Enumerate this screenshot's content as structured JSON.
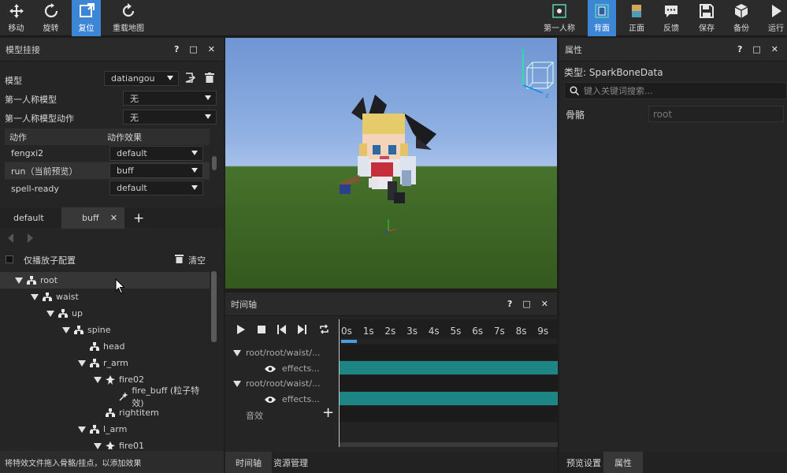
{
  "toolbar": {
    "left": [
      {
        "label": "移动",
        "icon": "move-icon"
      },
      {
        "label": "旋转",
        "icon": "rotate-icon"
      },
      {
        "label": "复位",
        "icon": "reset-icon"
      },
      {
        "label": "重载地图",
        "icon": "reload-icon"
      }
    ],
    "right": [
      {
        "label": "第一人称",
        "icon": "first-person-icon"
      },
      {
        "label": "背面",
        "icon": "back-view-icon"
      },
      {
        "label": "正面",
        "icon": "front-view-icon"
      },
      {
        "label": "反馈",
        "icon": "feedback-icon"
      },
      {
        "label": "保存",
        "icon": "save-icon"
      },
      {
        "label": "备份",
        "icon": "backup-icon"
      },
      {
        "label": "运行",
        "icon": "run-icon"
      }
    ]
  },
  "model_panel": {
    "title": "模型挂接",
    "buttons": [
      "?",
      "□",
      "✕"
    ],
    "model_label": "模型",
    "model_value": "datiangou",
    "fp_model_label": "第一人称模型",
    "fp_model_value": "无",
    "fp_anim_label": "第一人称模型动作",
    "fp_anim_value": "无",
    "table_headers": [
      "动作",
      "动作效果"
    ],
    "table_rows": [
      {
        "action": "fengxi2",
        "effect": "default"
      },
      {
        "action": "run（当前预览）",
        "effect": "buff"
      },
      {
        "action": "spell-ready",
        "effect": "default"
      }
    ],
    "effect_tabs": [
      "default",
      "buff"
    ],
    "tab_close": "✕",
    "tab_add": "+",
    "only_child_label": "仅播放子配置",
    "clear_label": "清空",
    "footer_hint": "将特效文件拖入骨骼/挂点，以添加效果"
  },
  "bone_tree": [
    {
      "name": "root",
      "type": "bone",
      "level": 0,
      "expanded": true
    },
    {
      "name": "waist",
      "type": "bone",
      "level": 1,
      "expanded": true
    },
    {
      "name": "up",
      "type": "bone",
      "level": 2,
      "expanded": true
    },
    {
      "name": "spine",
      "type": "bone",
      "level": 3,
      "expanded": true
    },
    {
      "name": "head",
      "type": "bone",
      "level": 4,
      "expanded": false
    },
    {
      "name": "r_arm",
      "type": "bone",
      "level": 4,
      "expanded": true
    },
    {
      "name": "fire02",
      "type": "socket",
      "level": 5,
      "expanded": true
    },
    {
      "name": "fire_buff (粒子特效)",
      "type": "effect",
      "level": 6,
      "expanded": false
    },
    {
      "name": "rightitem",
      "type": "bone",
      "level": 5,
      "expanded": false
    },
    {
      "name": "l_arm",
      "type": "bone",
      "level": 4,
      "expanded": true
    },
    {
      "name": "fire01",
      "type": "socket",
      "level": 5,
      "expanded": true
    }
  ],
  "timeline": {
    "title": "时间轴",
    "buttons": [
      "?",
      "□",
      "✕"
    ],
    "ticks": [
      "0s",
      "1s",
      "2s",
      "3s",
      "4s",
      "5s",
      "6s",
      "7s",
      "8s",
      "9s"
    ],
    "tracks": [
      {
        "label": "root/root/waist/...",
        "child": "effects..."
      },
      {
        "label": "root/root/waist/...",
        "child": "effects..."
      }
    ],
    "sound_label": "音效",
    "track_color": "#1e8585",
    "playhead_color": "#4a9ee0"
  },
  "bottom_tabs_left": [
    "时间轴",
    "资源管理"
  ],
  "properties": {
    "title": "属性",
    "buttons": [
      "?",
      "□",
      "✕"
    ],
    "type_text": "类型: SparkBoneData",
    "search_placeholder": "键入关键词搜索...",
    "bone_label": "骨骼",
    "bone_value": "root"
  },
  "bottom_tabs_right": [
    "预览设置",
    "属性"
  ]
}
